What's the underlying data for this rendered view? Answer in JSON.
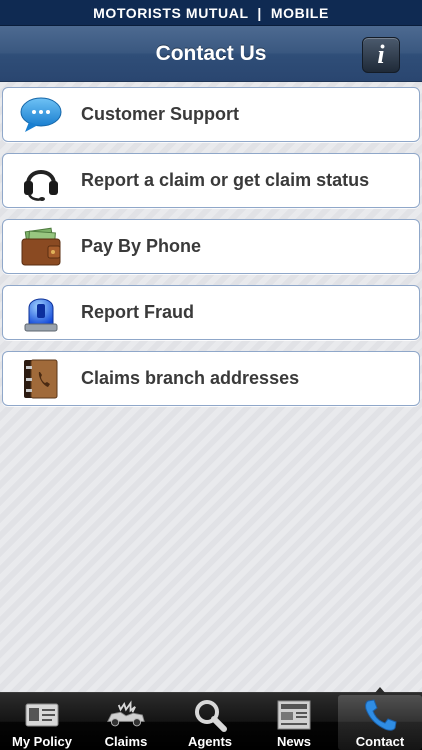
{
  "brand": {
    "text": "MOTORISTS MUTUAL  |  MOBILE"
  },
  "navbar": {
    "title": "Contact Us",
    "info_label": "i"
  },
  "menu": [
    {
      "label": "Customer Support",
      "icon": "speech-bubble-icon"
    },
    {
      "label": "Report a claim or get claim status",
      "icon": "headset-icon"
    },
    {
      "label": "Pay By Phone",
      "icon": "wallet-icon"
    },
    {
      "label": "Report Fraud",
      "icon": "siren-icon"
    },
    {
      "label": "Claims branch addresses",
      "icon": "address-book-icon"
    }
  ],
  "tabs": [
    {
      "label": "My Policy",
      "icon": "id-card-icon"
    },
    {
      "label": "Claims",
      "icon": "car-crash-icon"
    },
    {
      "label": "Agents",
      "icon": "magnifier-icon"
    },
    {
      "label": "News",
      "icon": "newspaper-icon"
    },
    {
      "label": "Contact",
      "icon": "phone-icon",
      "active": true
    }
  ],
  "colors": {
    "brand": "#0f2a52",
    "navbar": "#3a5880",
    "item_border": "#8fa7c9",
    "tab_bar": "#000000"
  }
}
